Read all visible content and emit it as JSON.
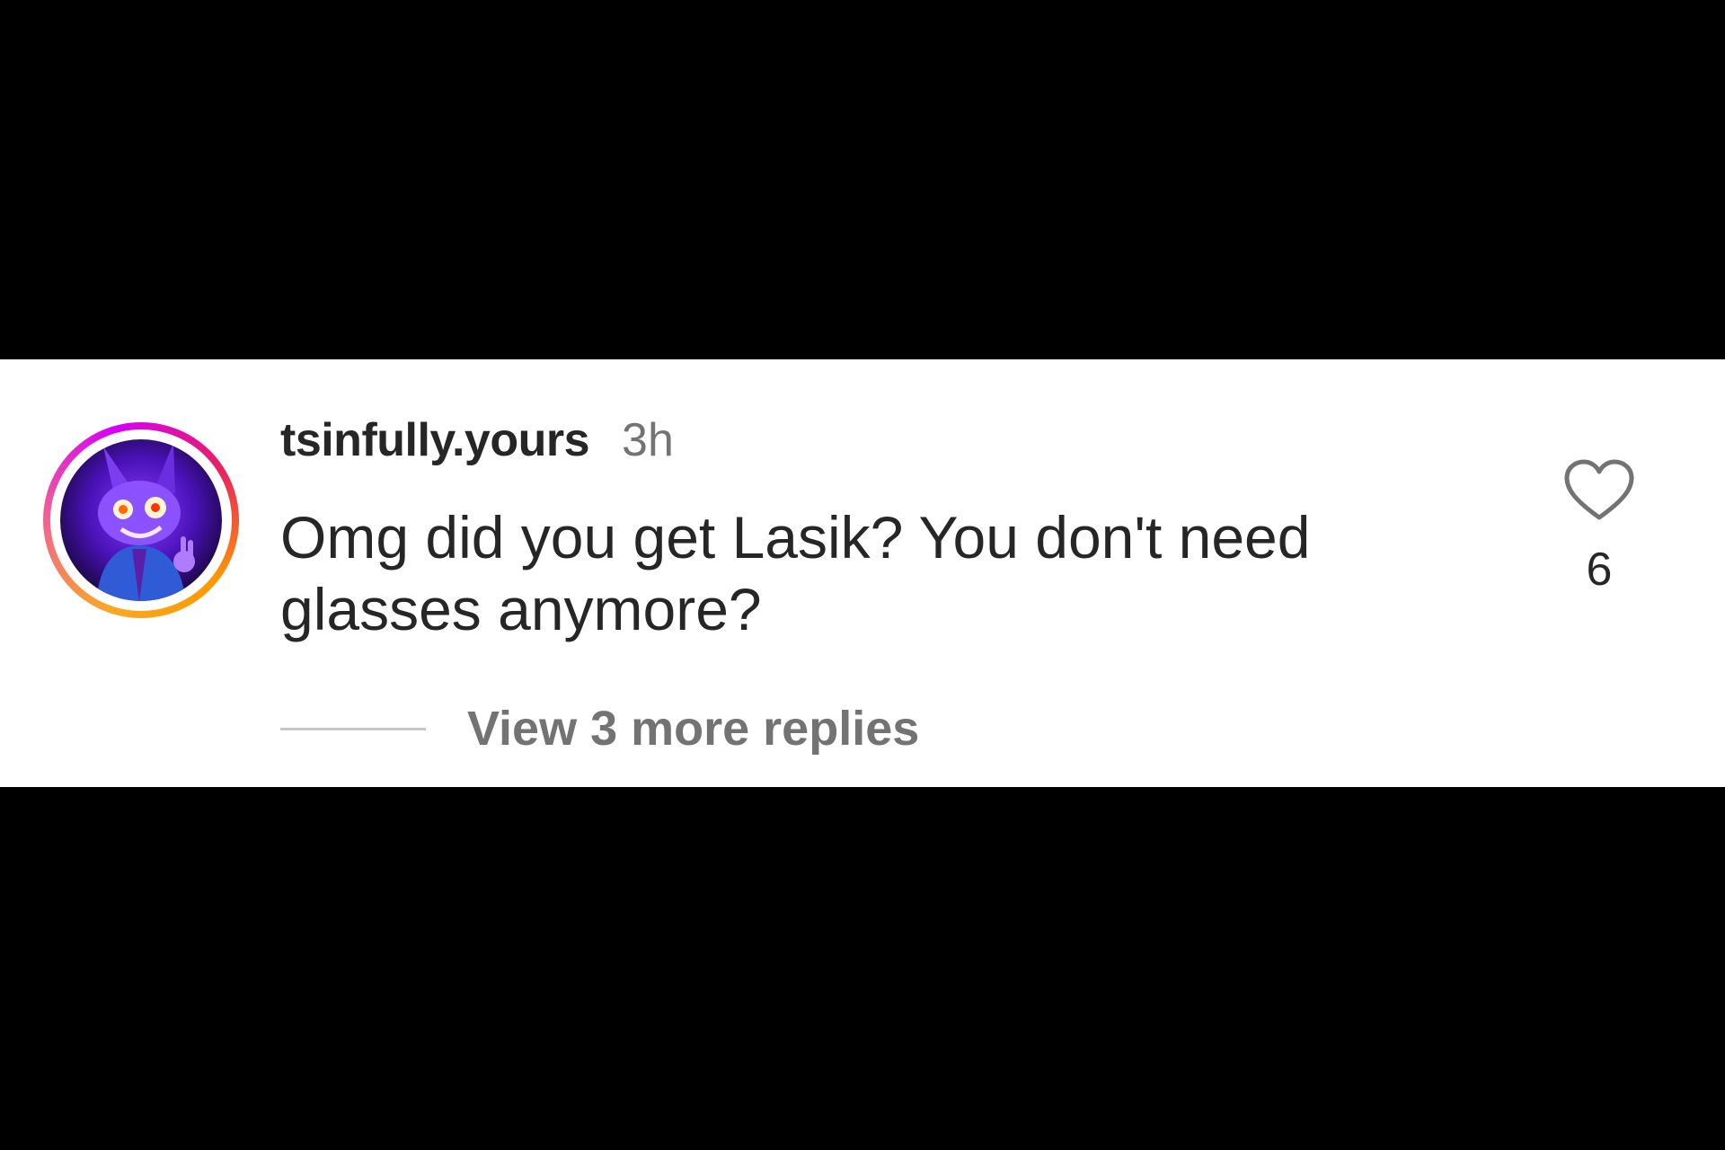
{
  "comment": {
    "username": "tsinfully.yours",
    "timestamp": "3h",
    "text": "Omg did you get Lasik? You don't need glasses anymore?",
    "like_count": "6",
    "view_replies_label": "View 3 more replies"
  },
  "icons": {
    "like": "heart-outline-icon",
    "avatar": "purple-bunny-character-avatar"
  },
  "colors": {
    "background": "#000000",
    "card": "#ffffff",
    "text_primary": "#262626",
    "text_secondary": "#737373",
    "story_ring": [
      "#f9a825",
      "#f06292",
      "#d500f9"
    ]
  }
}
